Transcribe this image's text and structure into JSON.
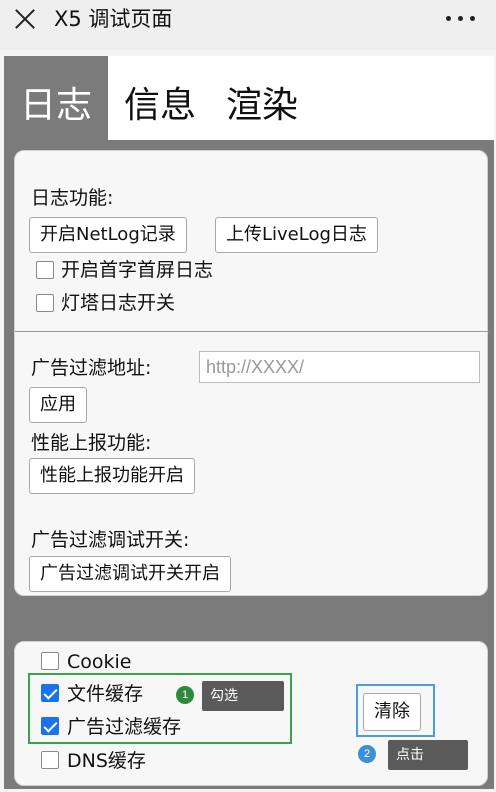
{
  "topbar": {
    "title": "X5 调试页面"
  },
  "tabs": [
    {
      "label": "日志"
    },
    {
      "label": "信息"
    },
    {
      "label": "渲染"
    }
  ],
  "log_section": {
    "heading": "日志功能:",
    "netlog_button": "开启NetLog记录",
    "livelog_button": "上传LiveLog日志",
    "first_screen_checkbox": "开启首字首屏日志",
    "beacon_checkbox": "灯塔日志开关"
  },
  "ad_filter": {
    "address_label": "广告过滤地址:",
    "address_placeholder": "http://XXXX/",
    "apply_button": "应用"
  },
  "perf": {
    "heading": "性能上报功能:",
    "button": "性能上报功能开启"
  },
  "ad_debug": {
    "heading": "广告过滤调试开关:",
    "button": "广告过滤调试开关开启"
  },
  "cache": {
    "items": [
      {
        "label": "Cookie",
        "checked": false
      },
      {
        "label": "文件缓存",
        "checked": true
      },
      {
        "label": "广告过滤缓存",
        "checked": true
      },
      {
        "label": "DNS缓存",
        "checked": false
      }
    ],
    "clear_button": "清除"
  },
  "annotations": {
    "step1_number": "1",
    "step1_text": "勾选",
    "step2_number": "2",
    "step2_text": "点击"
  },
  "colors": {
    "checkbox_checked": "#1a73e8",
    "frame_gray": "#7b7b7b",
    "highlight_green": "#3aa34a",
    "highlight_blue": "#4a9be0"
  }
}
